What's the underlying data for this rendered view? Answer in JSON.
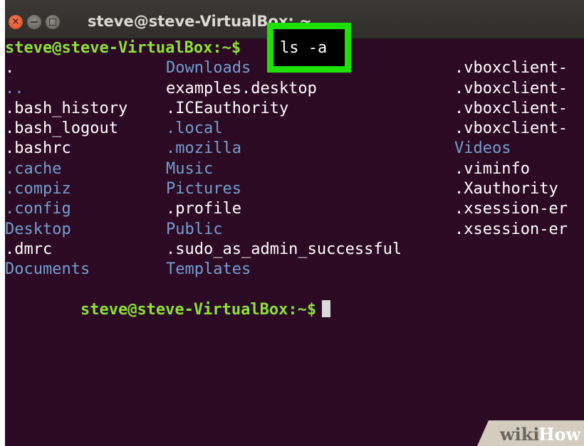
{
  "window": {
    "title": "steve@steve-VirtualBox: ~",
    "close_glyph": "×"
  },
  "terminal": {
    "prompt": "steve@steve-VirtualBox:~$",
    "command": "ls -a",
    "rows": [
      [
        {
          "text": ".",
          "kind": "file"
        },
        {
          "text": "Downloads",
          "kind": "dir"
        },
        {
          "text": ".vboxclient-",
          "kind": "file"
        }
      ],
      [
        {
          "text": "..",
          "kind": "dir"
        },
        {
          "text": "examples.desktop",
          "kind": "file"
        },
        {
          "text": ".vboxclient-",
          "kind": "file"
        }
      ],
      [
        {
          "text": ".bash_history",
          "kind": "file"
        },
        {
          "text": ".ICEauthority",
          "kind": "file"
        },
        {
          "text": ".vboxclient-",
          "kind": "file"
        }
      ],
      [
        {
          "text": ".bash_logout",
          "kind": "file"
        },
        {
          "text": ".local",
          "kind": "dir"
        },
        {
          "text": ".vboxclient-",
          "kind": "file"
        }
      ],
      [
        {
          "text": ".bashrc",
          "kind": "file"
        },
        {
          "text": ".mozilla",
          "kind": "dir"
        },
        {
          "text": "Videos",
          "kind": "dir"
        }
      ],
      [
        {
          "text": ".cache",
          "kind": "dir"
        },
        {
          "text": "Music",
          "kind": "dir"
        },
        {
          "text": ".viminfo",
          "kind": "file"
        }
      ],
      [
        {
          "text": ".compiz",
          "kind": "dir"
        },
        {
          "text": "Pictures",
          "kind": "dir"
        },
        {
          "text": ".Xauthority",
          "kind": "file"
        }
      ],
      [
        {
          "text": ".config",
          "kind": "dir"
        },
        {
          "text": ".profile",
          "kind": "file"
        },
        {
          "text": ".xsession-er",
          "kind": "file"
        }
      ],
      [
        {
          "text": "Desktop",
          "kind": "dir"
        },
        {
          "text": "Public",
          "kind": "dir"
        },
        {
          "text": ".xsession-er",
          "kind": "file"
        }
      ],
      [
        {
          "text": ".dmrc",
          "kind": "file"
        },
        {
          "text": ".sudo_as_admin_successful",
          "kind": "file"
        },
        {
          "text": "",
          "kind": "file"
        }
      ],
      [
        {
          "text": "Documents",
          "kind": "dir"
        },
        {
          "text": "Templates",
          "kind": "dir"
        },
        {
          "text": "",
          "kind": "file"
        }
      ]
    ]
  },
  "watermark": {
    "wiki": "wiki",
    "how": "How"
  },
  "colors": {
    "background": "#2c0a23",
    "prompt": "#8ae234",
    "directory": "#729fcf",
    "file": "#ffffff",
    "highlight_border": "#1ee100"
  }
}
